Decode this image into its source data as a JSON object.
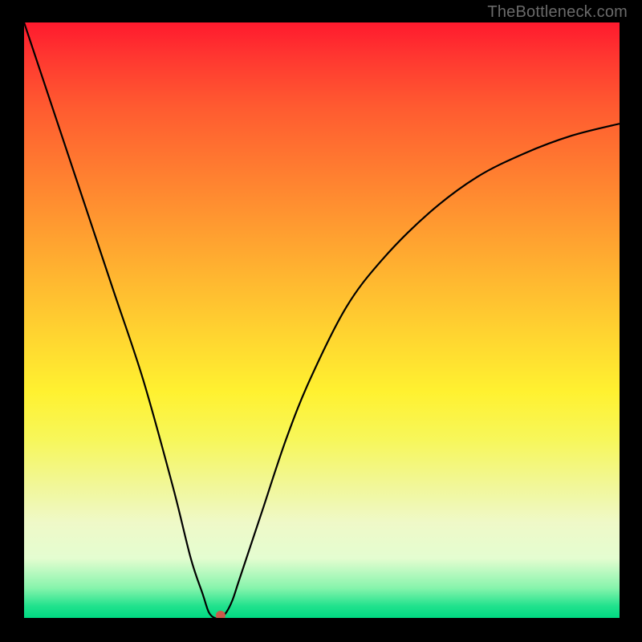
{
  "watermark": "TheBottleneck.com",
  "chart_data": {
    "type": "line",
    "title": "",
    "xlabel": "",
    "ylabel": "",
    "xlim": [
      0,
      100
    ],
    "ylim": [
      0,
      100
    ],
    "series": [
      {
        "name": "bottleneck-curve",
        "x": [
          0,
          5,
          10,
          15,
          20,
          25,
          28,
          30,
          31,
          32,
          33,
          34,
          35,
          36,
          38,
          40,
          44,
          48,
          54,
          60,
          68,
          76,
          84,
          92,
          100
        ],
        "y": [
          100,
          85,
          70,
          55,
          40,
          22,
          10,
          4,
          1,
          0,
          0,
          1,
          3,
          6,
          12,
          18,
          30,
          40,
          52,
          60,
          68,
          74,
          78,
          81,
          83
        ]
      }
    ],
    "marker": {
      "x": 33,
      "y": 0
    },
    "background": {
      "type": "vertical-gradient",
      "stops": [
        {
          "pos": 0,
          "color": "#ff1a2e"
        },
        {
          "pos": 50,
          "color": "#ffd930"
        },
        {
          "pos": 100,
          "color": "#00d982"
        }
      ]
    }
  }
}
